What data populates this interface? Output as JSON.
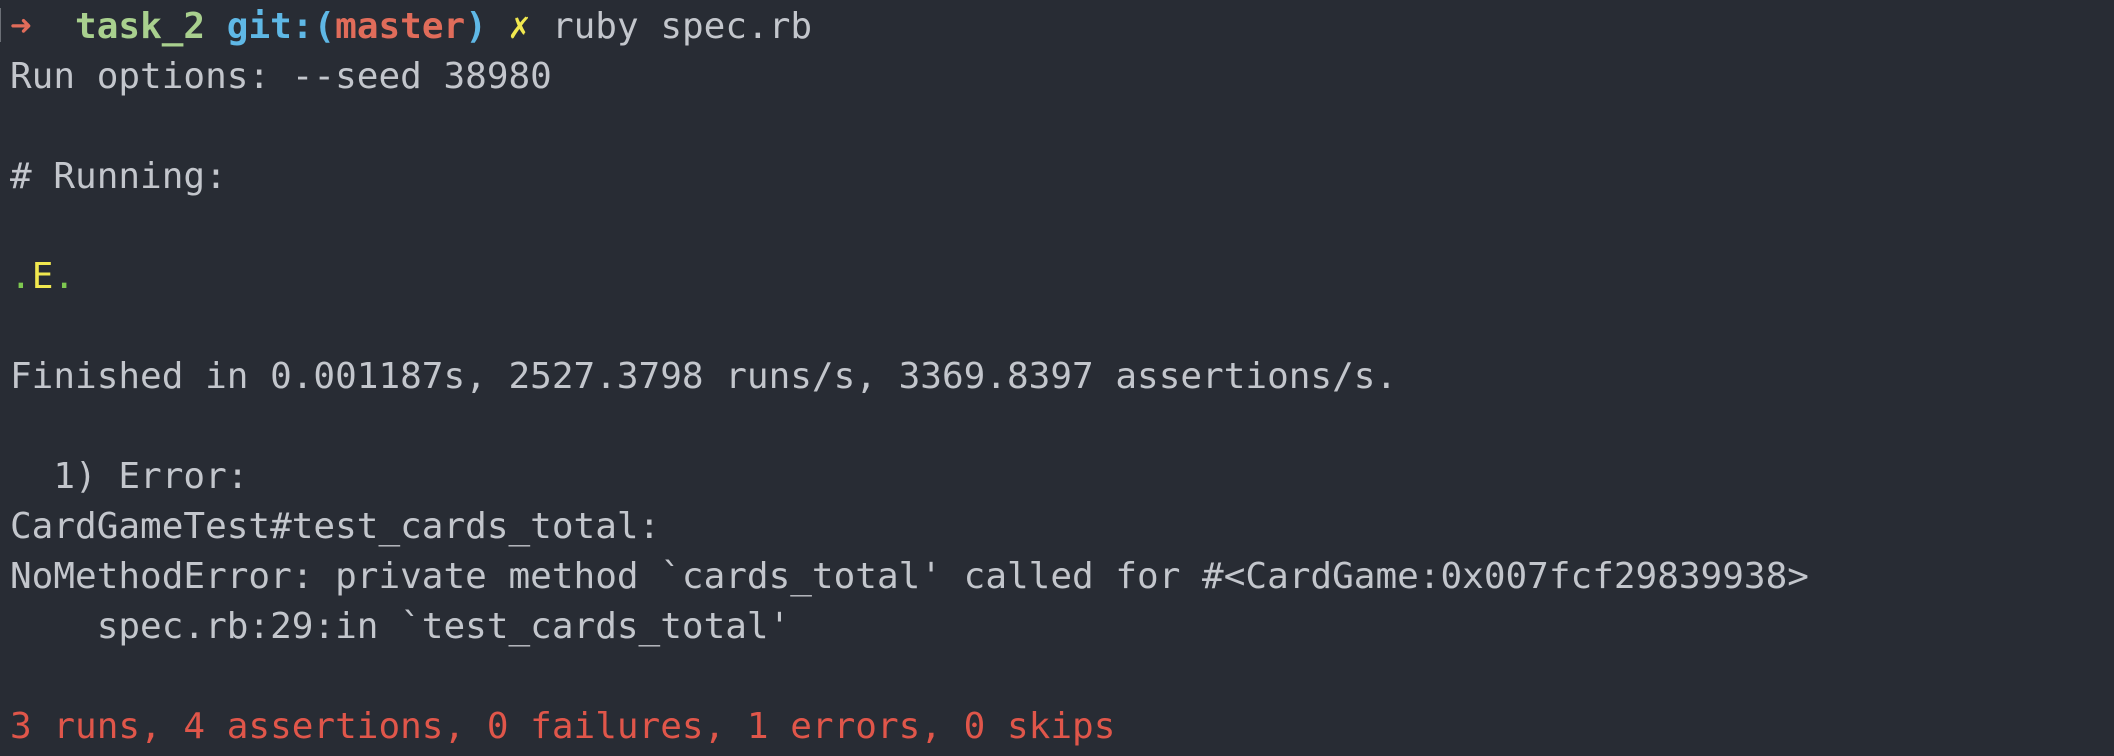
{
  "prompt": {
    "arrow": "➜",
    "directory": "task_2",
    "git_prefix": "git:(",
    "branch": "master",
    "git_suffix": ")",
    "dirty_marker": "✗",
    "command": "ruby spec.rb"
  },
  "output": {
    "run_options": "Run options: --seed 38980",
    "running_header": "# Running:",
    "progress": [
      {
        "char": ".",
        "status": "pass"
      },
      {
        "char": "E",
        "status": "error"
      },
      {
        "char": ".",
        "status": "pass"
      }
    ],
    "finished": "Finished in 0.001187s, 2527.3798 runs/s, 3369.8397 assertions/s.",
    "error_heading": "  1) Error:",
    "error_test": "CardGameTest#test_cards_total:",
    "error_message": "NoMethodError: private method `cards_total' called for #<CardGame:0x007fcf29839938>",
    "error_trace": "    spec.rb:29:in `test_cards_total'",
    "summary": "3 runs, 4 assertions, 0 failures, 1 errors, 0 skips"
  },
  "colors": {
    "background": "#282c34",
    "text": "#c3c6cc",
    "prompt_arrow": "#e06c5a",
    "directory": "#a9d08e",
    "git": "#5fb8e6",
    "branch": "#e06c5a",
    "dirty": "#f1e84f",
    "pass": "#7ec850",
    "error": "#f1e84f",
    "summary": "#e0564a"
  }
}
